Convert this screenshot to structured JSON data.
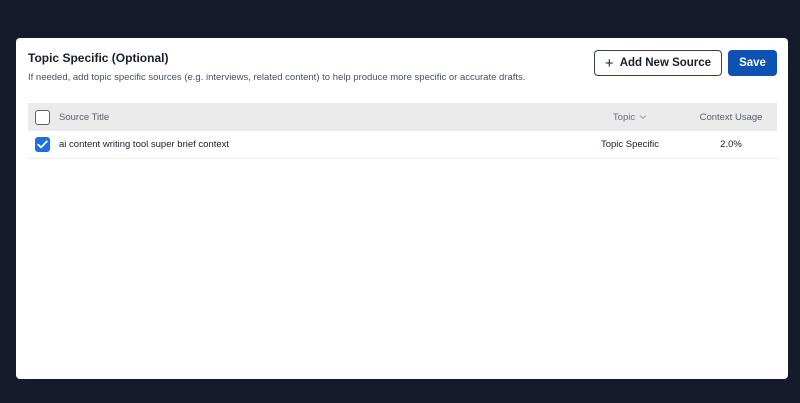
{
  "section": {
    "title": "Topic Specific (Optional)",
    "description": "If needed, add topic specific sources (e.g. interviews, related content) to help produce more specific or accurate drafts."
  },
  "actions": {
    "add_label": "Add New Source",
    "save_label": "Save"
  },
  "table": {
    "headers": {
      "title": "Source Title",
      "topic": "Topic",
      "usage": "Context Usage"
    },
    "rows": [
      {
        "checked": true,
        "title": "ai content writing tool super brief context",
        "topic": "Topic Specific",
        "usage": "2.0%"
      }
    ]
  },
  "colors": {
    "page_bg": "#141a2a",
    "primary": "#0d52b0",
    "checkbox": "#1b6fe0"
  }
}
